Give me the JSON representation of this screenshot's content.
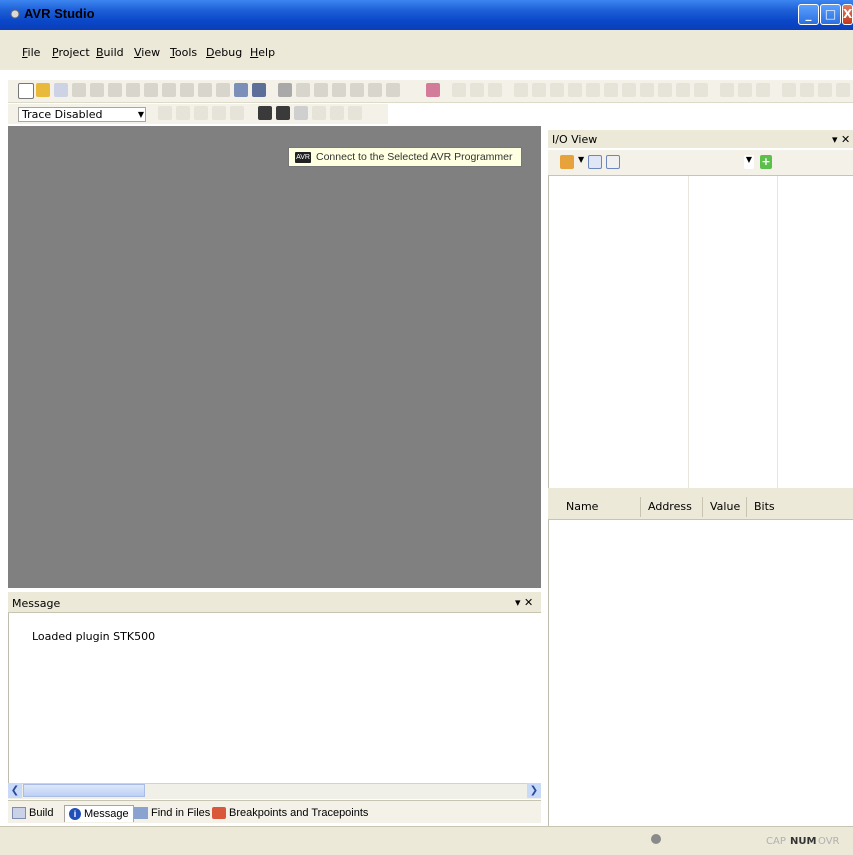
{
  "window": {
    "title": "AVR Studio"
  },
  "menubar": {
    "items": [
      "File",
      "Project",
      "Build",
      "View",
      "Tools",
      "Debug",
      "Help"
    ],
    "mnemonics": [
      "F",
      "P",
      "B",
      "V",
      "T",
      "D",
      "H"
    ]
  },
  "toolbar2": {
    "trace_mode": "Trace Disabled"
  },
  "workspace": {
    "tooltip": "Connect to the Selected AVR Programmer",
    "tooltip_icon_label": "AVR"
  },
  "message_panel": {
    "title": "Message",
    "lines": [
      "Loaded plugin STK500"
    ]
  },
  "bottom_tabs": [
    {
      "label": "Build",
      "icon": "build-icon"
    },
    {
      "label": "Message",
      "icon": "info-icon"
    },
    {
      "label": "Find in Files",
      "icon": "find-in-files-icon"
    },
    {
      "label": "Breakpoints and Tracepoints",
      "icon": "breakpoints-icon"
    }
  ],
  "io_view": {
    "title": "I/O View",
    "columns": [
      "Name",
      "Address",
      "Value",
      "Bits"
    ]
  },
  "statusbar": {
    "indicators": [
      "CAP",
      "NUM",
      "OVR"
    ],
    "active": "NUM"
  },
  "colors": {
    "titlebar": "#0a47c9",
    "workspace": "#808080",
    "chrome": "#ece9d8"
  }
}
